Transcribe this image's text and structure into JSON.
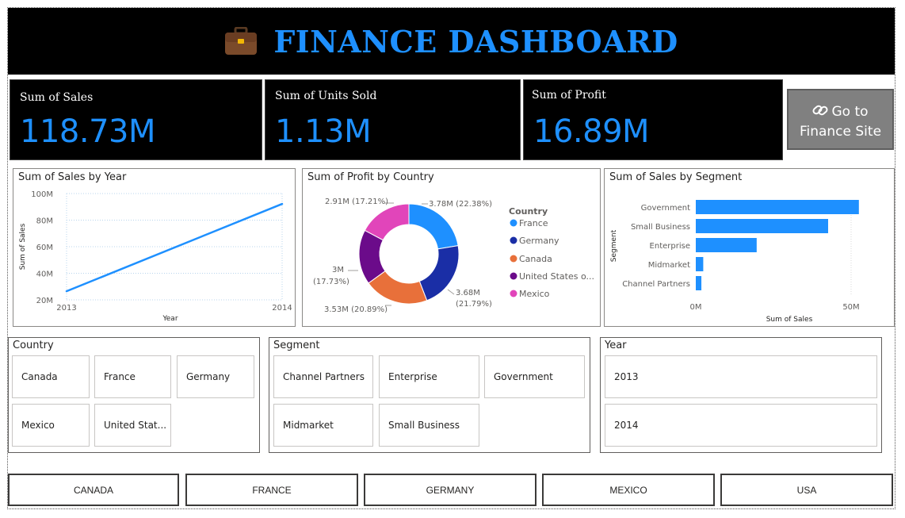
{
  "header": {
    "title": "FINANCE DASHBOARD",
    "icon": "briefcase-icon"
  },
  "kpis": [
    {
      "label": "Sum of Sales",
      "value": "118.73M"
    },
    {
      "label": "Sum of Units Sold",
      "value": "1.13M"
    },
    {
      "label": "Sum of Profit",
      "value": "16.89M"
    }
  ],
  "link_button": {
    "icon": "link-icon",
    "line1": "Go to",
    "line2": "Finance Site"
  },
  "colors": {
    "accent": "#1e90ff",
    "header_bg": "#000000",
    "button_grey": "#808080",
    "france": "#1e90ff",
    "germany": "#1a2ea6",
    "canada": "#e8703a",
    "usa": "#6b0b8a",
    "mexico": "#e145ba"
  },
  "line_chart": {
    "title": "Sum of Sales by Year",
    "xlabel": "Year",
    "ylabel": "Sum of Sales",
    "y_ticks": [
      "100M",
      "80M",
      "60M",
      "40M",
      "20M"
    ],
    "x_ticks": [
      "2013",
      "2014"
    ]
  },
  "donut_chart": {
    "title": "Sum of Profit by Country",
    "legend_title": "Country",
    "legend": [
      "France",
      "Germany",
      "Canada",
      "United States o...",
      "Mexico"
    ],
    "labels": {
      "france": "3.78M (22.38%)",
      "germany_1": "3.68M",
      "germany_2": "(21.79%)",
      "canada": "3.53M (20.89%)",
      "usa_1": "3M",
      "usa_2": "(17.73%)",
      "mexico": "2.91M (17.21%)"
    }
  },
  "bar_chart": {
    "title": "Sum of Sales by Segment",
    "xlabel": "Sum of Sales",
    "ylabel": "Segment",
    "categories": [
      "Government",
      "Small Business",
      "Enterprise",
      "Midmarket",
      "Channel Partners"
    ],
    "x_ticks": [
      "0M",
      "50M"
    ]
  },
  "chart_data": [
    {
      "type": "line",
      "title": "Sum of Sales by Year",
      "xlabel": "Year",
      "ylabel": "Sum of Sales",
      "x": [
        "2013",
        "2014"
      ],
      "series": [
        {
          "values": [
            26.5,
            92.2
          ]
        }
      ],
      "ylim": [
        20,
        100
      ],
      "y_unit": "M",
      "grid": true
    },
    {
      "type": "pie",
      "title": "Sum of Profit by Country",
      "legend_title": "Country",
      "categories": [
        "France",
        "Germany",
        "Canada",
        "United States of America",
        "Mexico"
      ],
      "values": [
        3.78,
        3.68,
        3.53,
        3.0,
        2.91
      ],
      "percents": [
        22.38,
        21.79,
        20.89,
        17.73,
        17.21
      ],
      "legend_position": "right"
    },
    {
      "type": "bar",
      "title": "Sum of Sales by Segment",
      "xlabel": "Sum of Sales",
      "ylabel": "Segment",
      "categories": [
        "Government",
        "Small Business",
        "Enterprise",
        "Midmarket",
        "Channel Partners"
      ],
      "values": [
        52.5,
        42.6,
        19.6,
        2.4,
        1.8
      ],
      "xlim": [
        0,
        60
      ],
      "x_unit": "M",
      "orientation": "horizontal"
    }
  ],
  "slicers": {
    "country": {
      "title": "Country",
      "items": [
        "Canada",
        "France",
        "Germany",
        "Mexico",
        "United Stat..."
      ]
    },
    "segment": {
      "title": "Segment",
      "items": [
        "Channel Partners",
        "Enterprise",
        "Government",
        "Midmarket",
        "Small Business"
      ]
    },
    "year": {
      "title": "Year",
      "items": [
        "2013",
        "2014"
      ]
    }
  },
  "nav_buttons": [
    "CANADA",
    "FRANCE",
    "GERMANY",
    "MEXICO",
    "USA"
  ]
}
